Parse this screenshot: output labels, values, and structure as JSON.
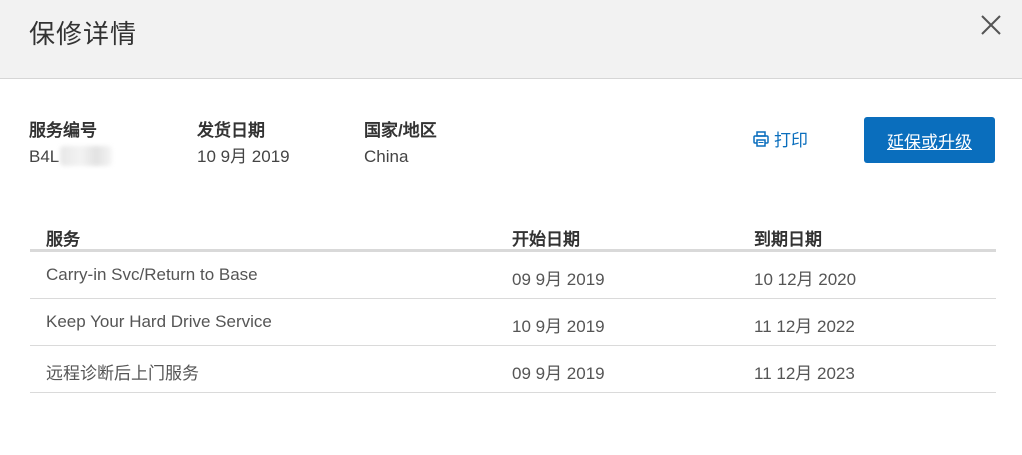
{
  "dialog": {
    "title": "保修详情",
    "close_icon": "close-icon"
  },
  "info": {
    "service_tag_label": "服务编号",
    "service_tag_value": "B4L",
    "ship_date_label": "发货日期",
    "ship_date_value": "10 9月 2019",
    "country_label": "国家/地区",
    "country_value": "China"
  },
  "actions": {
    "print_label": "打印",
    "print_icon": "printer-icon",
    "extend_label": "延保或升级"
  },
  "table": {
    "headers": [
      "服务",
      "开始日期",
      "到期日期"
    ],
    "rows": [
      [
        "Carry-in Svc/Return to Base",
        "09 9月 2019",
        "10 12月 2020"
      ],
      [
        "Keep Your Hard Drive Service",
        "10 9月 2019",
        "11 12月 2022"
      ],
      [
        "远程诊断后上门服务",
        "09 9月 2019",
        "11 12月 2023"
      ]
    ]
  },
  "colors": {
    "accent": "#0a6ebd",
    "header_bg": "#f2f2f2"
  }
}
